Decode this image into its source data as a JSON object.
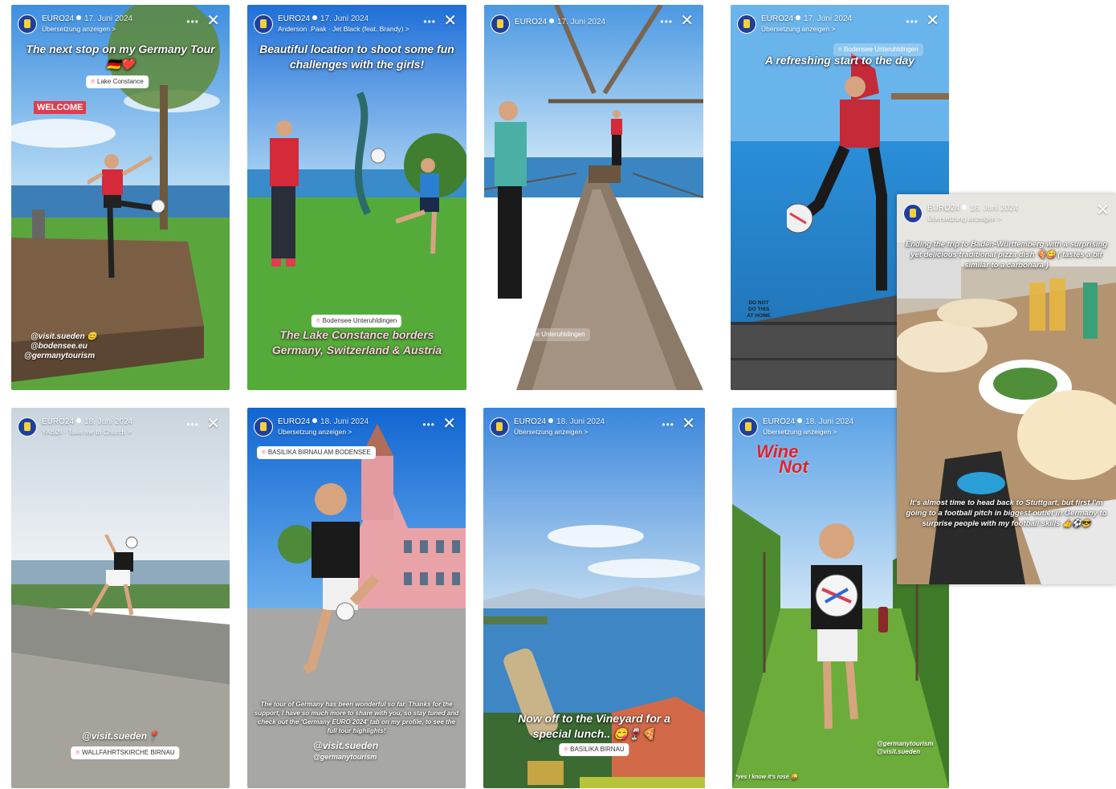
{
  "stories": [
    {
      "account": "EURO24",
      "date": "17. Juni 2024",
      "subline": "Übersetzung anzeigen >",
      "caption_top": "The next stop on my Germany Tour 🇩🇪❤️",
      "location": "Lake Constance",
      "badge": "WELCOME",
      "handles": [
        "@visit.sueden 😊",
        "@bodensee.eu",
        "@germanytourism"
      ]
    },
    {
      "account": "EURO24",
      "date": "17. Juni 2024",
      "subline": "Anderson .Paak · Jet Black (feat. Brandy) >",
      "caption_top": "Beautiful location to shoot some fun challenges with the girls!",
      "location": "Bodensee Unteruhldingen",
      "caption_bottom": "The Lake Constance borders Germany, Switzerland & Austria"
    },
    {
      "account": "EURO24",
      "date": "17. Juni 2024",
      "location": "Bodensee Unteruhldingen"
    },
    {
      "account": "EURO24",
      "date": "17. Juni 2024",
      "subline": "Übersetzung anzeigen >",
      "location": "Bodensee Unteruhldingen",
      "caption_top": "A refreshing start to the  day",
      "warning": "DO NOT DO THIS AT HOME"
    },
    {
      "account": "EURO24",
      "date": "18. Juni 2024",
      "subline": "Übersetzung anzeigen >",
      "caption_top": "Ending the trip to Baden-Württemberg with a surprising yet delicious traditional pizza dish 🍕😋 ( tastes a bit similar to a carbonara )",
      "caption_bottom": "It's almost time to head back to Stuttgart, but first I'm going to a football pitch in biggest outlet in Germany to surprise people with my football skills 👍⚽😎"
    },
    {
      "account": "EURO24",
      "date": "18. Juni 2024",
      "subline": "YABØI · Take me to Church >",
      "handle": "@visit.sueden📍",
      "location": "WALLFAHRTSKIRCHE BIRNAU"
    },
    {
      "account": "EURO24",
      "date": "18. Juni 2024",
      "subline": "Übersetzung anzeigen >",
      "location": "BASILIKA BIRNAU AM BODENSEE",
      "caption_bottom": "The tour of Germany has been wonderful so far. Thanks for the support, I have so much more to share with you, so stay tuned and check out the 'Germany EURO 2024' tab on my profile, to see the full tour highlights!",
      "handles": [
        "@visit.sueden",
        "@germanytourism"
      ]
    },
    {
      "account": "EURO24",
      "date": "18. Juni 2024",
      "subline": "Übersetzung anzeigen >",
      "caption_bottom": "Now off to the Vineyard for a special lunch.. 😋🍷🍕",
      "location": "BASILIKA BIRNAU"
    },
    {
      "account": "EURO24",
      "date": "18. Juni 2024",
      "subline": "Übersetzung anzeigen >",
      "sticker_top": "Wine",
      "sticker_bottom": "Not",
      "handles": [
        "@germanytourism",
        "@visit.sueden"
      ],
      "footnote": "*yes I know it's rosé 😜"
    }
  ],
  "colors": {
    "sky": "#5fa8e8",
    "lake": "#2d7fc4",
    "grass": "#4da33a",
    "wood": "#8a6a4a",
    "shirt_red": "#d42a3a",
    "shirt_black": "#1a1a1a",
    "church_pink": "#e9a3a8"
  }
}
